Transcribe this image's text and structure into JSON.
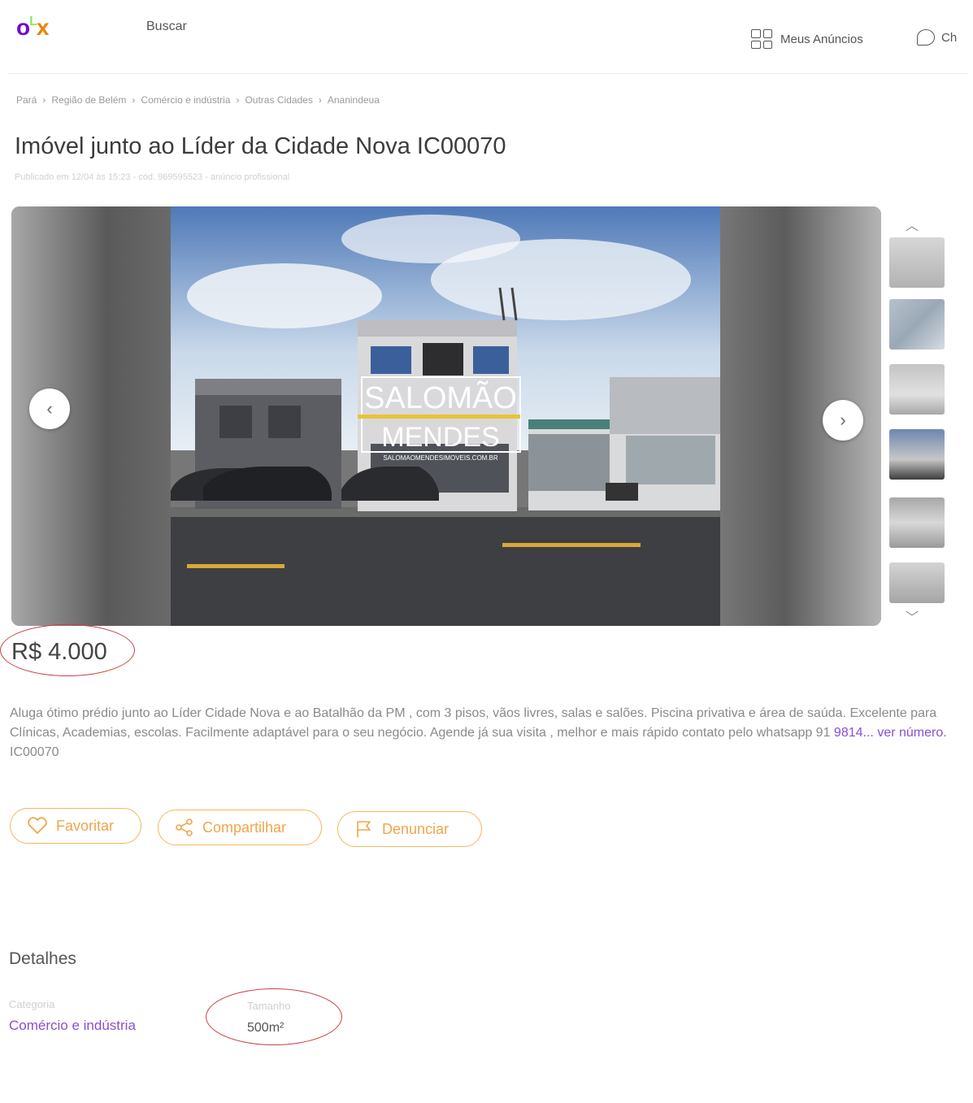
{
  "header": {
    "logo": {
      "o": "o",
      "l": "L",
      "x": "x"
    },
    "search_label": "Buscar",
    "my_ads_label": "Meus Anúncios",
    "chat_label": "Ch"
  },
  "breadcrumb": [
    "Pará",
    "Região de Belém",
    "Comércio e indústria",
    "Outras Cidades",
    "Ananindeua"
  ],
  "breadcrumb_separator": "›",
  "listing": {
    "title": "Imóvel junto ao Líder da Cidade Nova IC00070",
    "meta": "Publicado em 12/04 às 15:23 - cód. 969595523 - anúncio profissional",
    "price": "R$ 4.000",
    "description": "Aluga ótimo prédio junto ao Líder Cidade Nova e ao Batalhão da PM , com 3 pisos, vãos livres, salas e salões. Piscina privativa e área de saúda. Excelente para Clínicas, Academias, escolas. Facilmente adaptável para o seu negócio. Agende já sua visita , melhor e mais rápido contato pelo whatsapp 91 ",
    "phone_partial": "9814...",
    "view_number": "ver número.",
    "code_suffix": " IC00070"
  },
  "gallery": {
    "watermark_line1": "SALOMÃO",
    "watermark_line2": "MENDES",
    "watermark_small": "SALOMAOMENDESIMOVEIS.COM.BR",
    "prev_icon": "‹",
    "next_icon": "›",
    "thumb_up": "︿",
    "thumb_down": "﹀"
  },
  "actions": {
    "favorite": "Favoritar",
    "share": "Compartilhar",
    "report": "Denunciar"
  },
  "details": {
    "title": "Detalhes",
    "category_label": "Categoria",
    "category_value": "Comércio e indústria",
    "size_label": "Tamanho",
    "size_value": "500m²"
  },
  "colors": {
    "brand_purple": "#6e0ad6",
    "brand_orange": "#f28000",
    "brand_green": "#8ce563",
    "link_purple": "#8a4fd3",
    "button_orange": "#f5b75a",
    "annotation_red": "#c94040"
  }
}
